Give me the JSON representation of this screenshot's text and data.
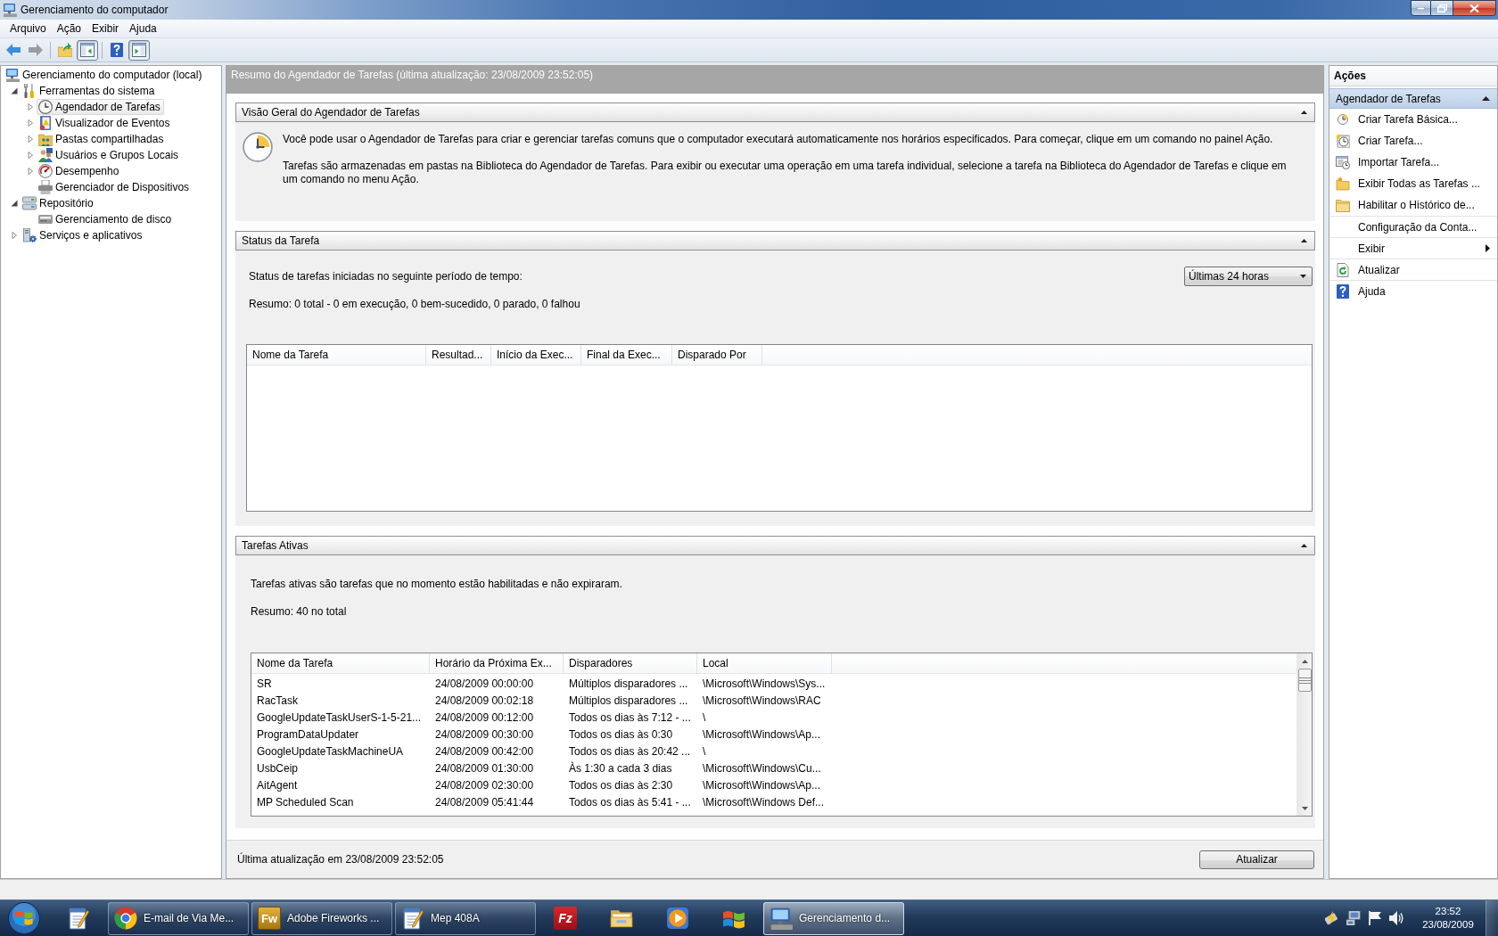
{
  "window": {
    "title": "Gerenciamento do computador"
  },
  "menu": [
    "Arquivo",
    "Ação",
    "Exibir",
    "Ajuda"
  ],
  "toolbar": [
    {
      "disabled": false,
      "pressed": false
    },
    {
      "disabled": true,
      "pressed": false
    },
    {
      "disabled": false,
      "pressed": false
    },
    {
      "disabled": false,
      "pressed": true
    },
    {
      "disabled": false,
      "pressed": false
    },
    {
      "disabled": false,
      "pressed": true
    }
  ],
  "tree": [
    {
      "label": "Gerenciamento do computador (local)",
      "expandable": false,
      "selected": false,
      "children": [
        {
          "label": "Ferramentas do sistema",
          "expandable": true,
          "expanded": true,
          "selected": false,
          "children": [
            {
              "label": "Agendador de Tarefas",
              "expandable": true,
              "expanded": false,
              "selected": true
            },
            {
              "label": "Visualizador de Eventos",
              "expandable": true,
              "expanded": false,
              "selected": false
            },
            {
              "label": "Pastas compartilhadas",
              "expandable": true,
              "expanded": false,
              "selected": false
            },
            {
              "label": "Usuários e Grupos Locais",
              "expandable": true,
              "expanded": false,
              "selected": false
            },
            {
              "label": "Desempenho",
              "expandable": true,
              "expanded": false,
              "selected": false
            },
            {
              "label": "Gerenciador de Dispositivos",
              "expandable": false,
              "selected": false
            }
          ]
        },
        {
          "label": "Repositório",
          "expandable": true,
          "expanded": true,
          "selected": false,
          "children": [
            {
              "label": "Gerenciamento de disco",
              "expandable": false,
              "selected": false
            }
          ]
        },
        {
          "label": "Serviços e aplicativos",
          "expandable": true,
          "expanded": false,
          "selected": false
        }
      ]
    }
  ],
  "summary": {
    "title": "Resumo do Agendador de Tarefas (última atualização: 23/08/2009 23:52:05)",
    "overview": {
      "title": "Visão Geral do Agendador de Tarefas",
      "expanded": true,
      "paragraphs": [
        "Você pode usar o Agendador de Tarefas para criar e gerenciar tarefas comuns que o computador executará automaticamente nos horários especificados. Para começar, clique em um comando no painel Ação.",
        "Tarefas são armazenadas em pastas na Biblioteca do Agendador de Tarefas. Para exibir ou executar uma operação em uma tarefa individual, selecione a tarefa na Biblioteca do Agendador de Tarefas e clique em um comando no menu Ação."
      ]
    },
    "status": {
      "title": "Status da Tarefa",
      "expanded": true,
      "period_label": "Status de tarefas iniciadas no seguinte período de tempo:",
      "period": "Últimas 24 horas",
      "summary": "Resumo: 0 total - 0 em execução, 0 bem-sucedido, 0 parado, 0 falhou",
      "table": {
        "columns": [
          "Nome da Tarefa",
          "Resultad...",
          "Início da Exec...",
          "Final da Exec...",
          "Disparado Por"
        ]
      }
    },
    "active": {
      "title": "Tarefas Ativas",
      "expanded": true,
      "description": "Tarefas ativas são tarefas que no momento estão habilitadas e não expiraram.",
      "summary": "Resumo: 40 no total",
      "table": {
        "columns": [
          "Nome da Tarefa",
          "Horário da Próxima Ex...",
          "Disparadores",
          "Local"
        ],
        "rows": [
          [
            "SR",
            "24/08/2009 00:00:00",
            "Múltiplos disparadores ...",
            "\\Microsoft\\Windows\\Sys..."
          ],
          [
            "RacTask",
            "24/08/2009 00:02:18",
            "Múltiplos disparadores ...",
            "\\Microsoft\\Windows\\RAC"
          ],
          [
            "GoogleUpdateTaskUserS-1-5-21...",
            "24/08/2009 00:12:00",
            "Todos os dias às 7:12 - ...",
            "\\"
          ],
          [
            "ProgramDataUpdater",
            "24/08/2009 00:30:00",
            "Todos os dias às 0:30",
            "\\Microsoft\\Windows\\Ap..."
          ],
          [
            "GoogleUpdateTaskMachineUA",
            "24/08/2009 00:42:00",
            "Todos os dias às 20:42 ...",
            "\\"
          ],
          [
            "UsbCeip",
            "24/08/2009 01:30:00",
            "Às 1:30 a cada 3 dias",
            "\\Microsoft\\Windows\\Cu..."
          ],
          [
            "AitAgent",
            "24/08/2009 02:30:00",
            "Todos os dias às 2:30",
            "\\Microsoft\\Windows\\Ap..."
          ],
          [
            "MP Scheduled Scan",
            "24/08/2009 05:41:44",
            "Todos os dias às 5:41 - ...",
            "\\Microsoft\\Windows Def..."
          ]
        ]
      }
    },
    "last_update": "Última atualização em 23/08/2009 23:52:05",
    "refresh_button": "Atualizar"
  },
  "actions": {
    "title": "Ações",
    "section": {
      "title": "Agendador de Tarefas",
      "expanded": true
    },
    "items": [
      {
        "label": "Criar Tarefa Básica...",
        "separator": false,
        "submenu": false
      },
      {
        "label": "Criar Tarefa...",
        "separator": false,
        "submenu": false
      },
      {
        "label": "Importar Tarefa...",
        "separator": false,
        "submenu": false
      },
      {
        "label": "Exibir Todas as Tarefas ...",
        "separator": false,
        "submenu": false
      },
      {
        "label": "Habilitar o Histórico de...",
        "separator": false,
        "submenu": false
      },
      {
        "label": "Configuração da Conta...",
        "separator": true,
        "submenu": false
      },
      {
        "label": "Exibir",
        "separator": true,
        "submenu": true
      },
      {
        "label": "Atualizar",
        "separator": true,
        "submenu": false
      },
      {
        "label": "Ajuda",
        "separator": true,
        "submenu": false
      }
    ]
  },
  "taskbar": {
    "items": [
      {
        "kind": "pinned",
        "selected": false
      },
      {
        "kind": "window",
        "label": "E-mail de Via Me...",
        "selected": false
      },
      {
        "kind": "window",
        "logo_text": "Fw",
        "label": "Adobe Fireworks ...",
        "selected": false
      },
      {
        "kind": "window",
        "label": "Mep 408A",
        "selected": false
      },
      {
        "kind": "pinned",
        "logo_text": "Fz",
        "selected": false
      },
      {
        "kind": "pinned",
        "selected": false
      },
      {
        "kind": "pinned",
        "selected": false
      },
      {
        "kind": "pinned",
        "selected": false
      },
      {
        "kind": "window",
        "label": "Gerenciamento d...",
        "selected": true
      }
    ],
    "tray": {
      "time": "23:52",
      "date": "23/08/2009"
    }
  }
}
